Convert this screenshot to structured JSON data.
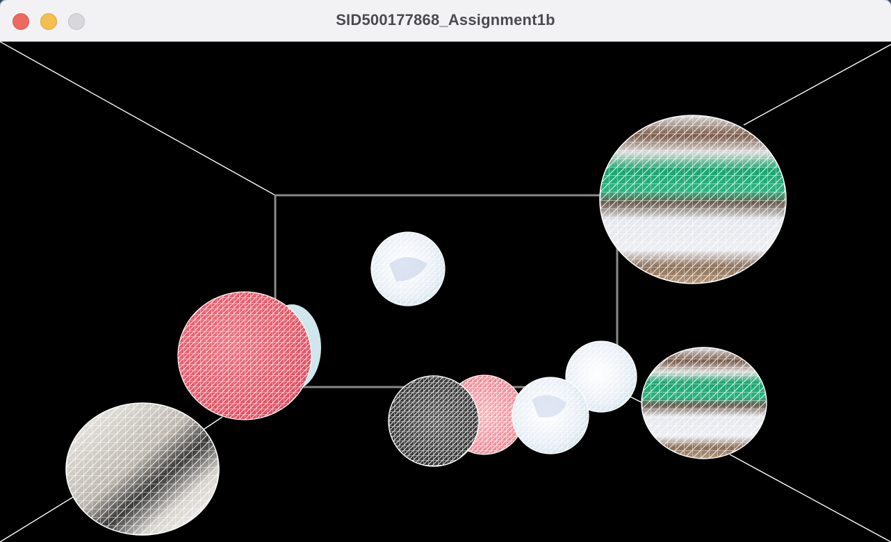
{
  "window": {
    "title": "SID500177868_Assignment1b"
  },
  "controls": {
    "close": "close-icon",
    "minimize": "minimize-icon",
    "zoom": "zoom-icon"
  },
  "colors": {
    "close": "#ed6a5e",
    "minimize": "#f5bf4f",
    "zoom": "#d8d8dc",
    "scene_background": "#000000",
    "room_lines": "#ffffff",
    "back_wall": "#8a8a8a"
  },
  "scene": {
    "spheres": [
      {
        "name": "sphere-green-large",
        "texture": "green-white-brown"
      },
      {
        "name": "sphere-white-small-center",
        "texture": "white-blue"
      },
      {
        "name": "sphere-red-large",
        "texture": "red"
      },
      {
        "name": "sphere-white-grey-bottom-left",
        "texture": "white-grey"
      },
      {
        "name": "sphere-black-white",
        "texture": "black-white"
      },
      {
        "name": "sphere-pink",
        "texture": "pink"
      },
      {
        "name": "sphere-white-blue-mid",
        "texture": "white-blue"
      },
      {
        "name": "sphere-white-blue-upper",
        "texture": "white-blue"
      },
      {
        "name": "sphere-green-medium",
        "texture": "green-white-brown"
      }
    ]
  }
}
